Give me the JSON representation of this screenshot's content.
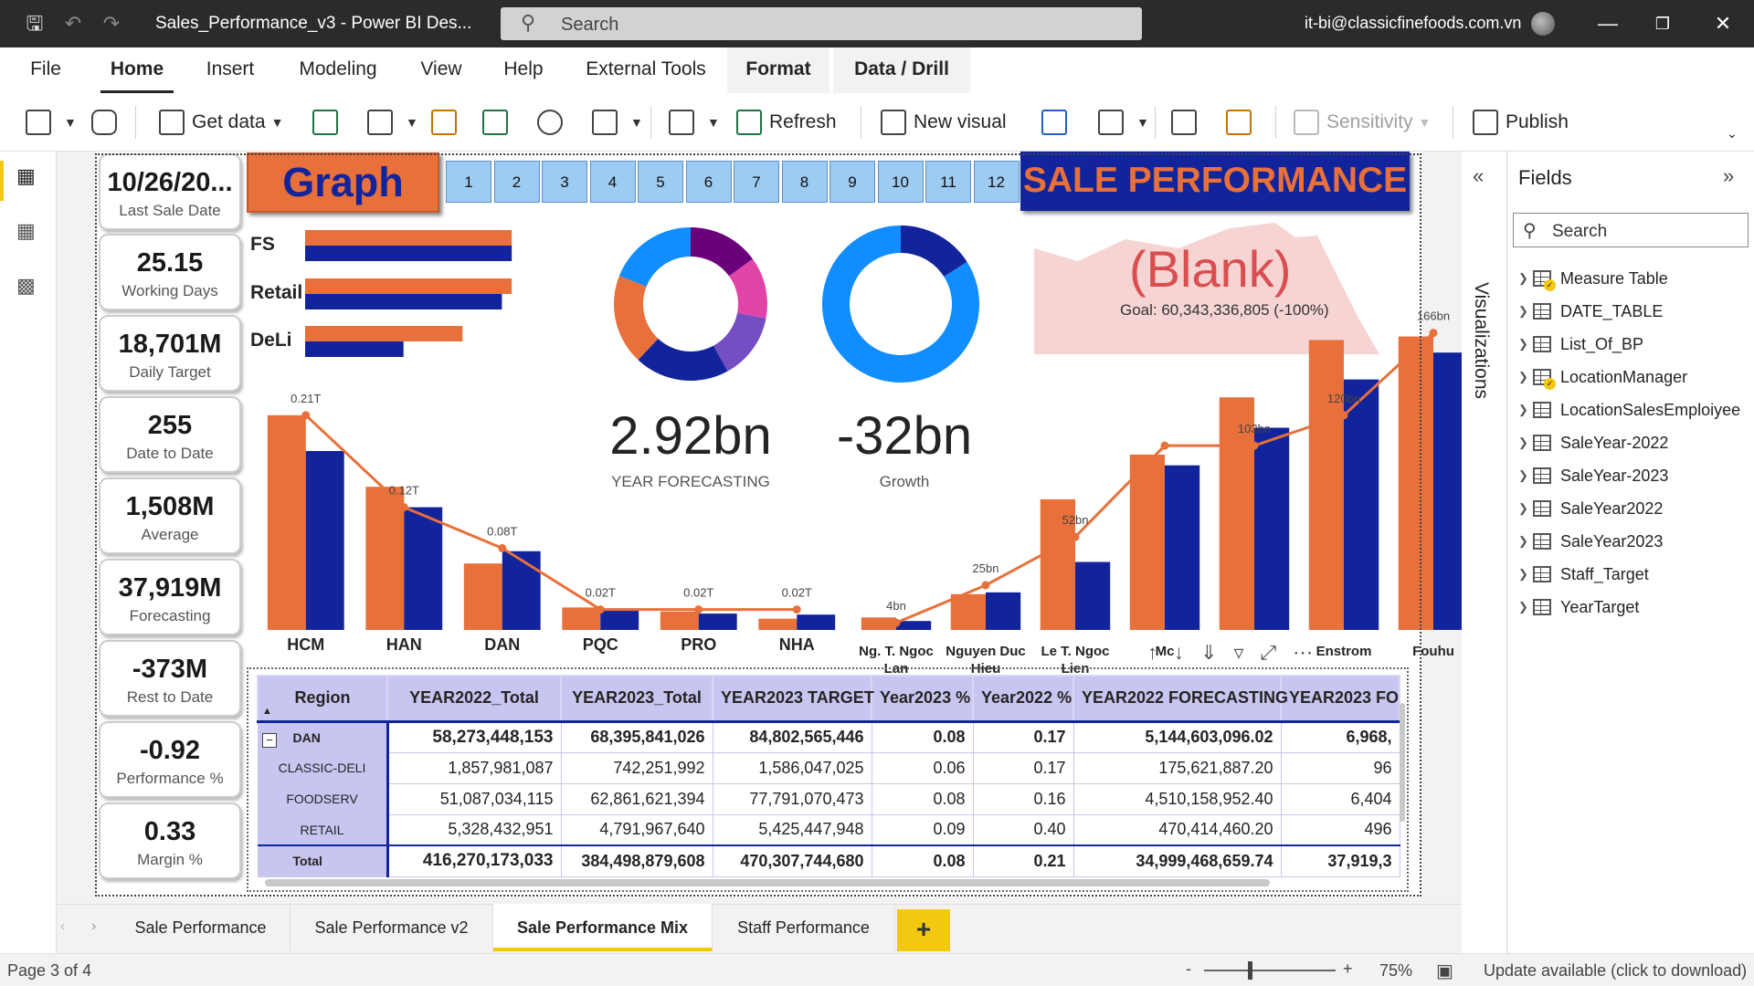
{
  "titlebar": {
    "doc_title": "Sales_Performance_v3 - Power BI Des...",
    "search_placeholder": "Search",
    "user": "it-bi@classicfinefoods.com.vn"
  },
  "menu": {
    "file": "File",
    "home": "Home",
    "insert": "Insert",
    "modeling": "Modeling",
    "view": "View",
    "help": "Help",
    "external": "External Tools",
    "format": "Format",
    "datadrill": "Data / Drill"
  },
  "ribbon": {
    "get_data": "Get data",
    "refresh": "Refresh",
    "new_visual": "New visual",
    "sensitivity": "Sensitivity",
    "publish": "Publish"
  },
  "kpis": [
    {
      "value": "10/26/20...",
      "label": "Last Sale Date"
    },
    {
      "value": "25.15",
      "label": "Working Days"
    },
    {
      "value": "18,701M",
      "label": "Daily Target"
    },
    {
      "value": "255",
      "label": "Date to Date"
    },
    {
      "value": "1,508M",
      "label": "Average"
    },
    {
      "value": "37,919M",
      "label": "Forecasting"
    },
    {
      "value": "-373M",
      "label": "Rest to Date"
    },
    {
      "value": "-0.92",
      "label": "Performance %"
    },
    {
      "value": "0.33",
      "label": "Margin %"
    }
  ],
  "graph_button": "Graph",
  "months": [
    "1",
    "2",
    "3",
    "4",
    "5",
    "6",
    "7",
    "8",
    "9",
    "10",
    "11",
    "12"
  ],
  "banner": "SALE PERFORMANCE",
  "blank_card": {
    "value": "(Blank)",
    "goal": "Goal: 60,343,336,805 (-100%)"
  },
  "forecast": {
    "value": "2.92bn",
    "label": "YEAR FORECASTING"
  },
  "growth": {
    "value": "-32bn",
    "label": "Growth"
  },
  "colors": {
    "orange": "#e8703a",
    "navy": "#12249b",
    "blue": "#118dff",
    "purple": "#6b007b",
    "magenta": "#e044a7",
    "violet": "#744ec2"
  },
  "chart_data": [
    {
      "type": "bar",
      "orientation": "horizontal",
      "categories": [
        "FS",
        "Retail",
        "DeLi"
      ],
      "series": [
        {
          "values": [
            63,
            63,
            48
          ]
        },
        {
          "values": [
            63,
            60,
            30
          ]
        }
      ]
    },
    {
      "type": "pie",
      "variant": "donut",
      "slices": [
        {
          "color": "#6b007b",
          "value": 15
        },
        {
          "color": "#e044a7",
          "value": 13
        },
        {
          "color": "#744ec2",
          "value": 14
        },
        {
          "color": "#12249b",
          "value": 20
        },
        {
          "color": "#e8703a",
          "value": 19
        },
        {
          "color": "#118dff",
          "value": 19
        }
      ]
    },
    {
      "type": "pie",
      "variant": "donut",
      "slices": [
        {
          "color": "#12249b",
          "value": 16
        },
        {
          "color": "#118dff",
          "value": 84
        }
      ]
    },
    {
      "type": "bar",
      "categories": [
        "HCM",
        "HAN",
        "DAN",
        "PQC",
        "PRO",
        "NHA"
      ],
      "series": [
        {
          "values": [
            0.21,
            0.14,
            0.065,
            0.022,
            0.018,
            0.011
          ]
        },
        {
          "values": [
            0.175,
            0.12,
            0.077,
            0.02,
            0.016,
            0.015
          ]
        }
      ],
      "line": {
        "values": [
          0.21,
          0.12,
          0.08,
          0.02,
          0.02,
          0.02
        ],
        "labels": [
          "0.21T",
          "0.12T",
          "0.08T",
          "0.02T",
          "0.02T",
          "0.02T"
        ]
      },
      "ylim": [
        0,
        0.25
      ]
    },
    {
      "type": "bar",
      "categories": [
        "Ng. T. Ngoc Lan",
        "Nguyen Duc Hieu",
        "Le T. Ngoc Lien",
        "Mc",
        "",
        "Enstrom",
        "Fouhu"
      ],
      "series": [
        {
          "values": [
            7,
            20,
            73,
            98,
            130,
            162,
            164
          ]
        },
        {
          "values": [
            5,
            21,
            38,
            92,
            113,
            140,
            155
          ]
        }
      ],
      "line": {
        "values": [
          4,
          25,
          52,
          103,
          103,
          120,
          166
        ],
        "labels": [
          "4bn",
          "25bn",
          "52bn",
          "",
          "103bn",
          "120bn",
          "166bn"
        ]
      },
      "ylim": [
        0,
        190
      ]
    },
    {
      "type": "table",
      "columns": [
        "Region",
        "YEAR2022_Total",
        "YEAR2023_Total",
        "YEAR2023 TARGET",
        "Year2023 %",
        "Year2022 %",
        "YEAR2022 FORECASTING",
        "YEAR2023 FO"
      ],
      "rows": [
        {
          "cells": [
            "DAN",
            "58,273,448,153",
            "68,395,841,026",
            "84,802,565,446",
            "0.08",
            "0.17",
            "5,144,603,096.02",
            "6,968,"
          ],
          "bold": true,
          "group": true
        },
        {
          "cells": [
            "CLASSIC-DELI",
            "1,857,981,087",
            "742,251,992",
            "1,586,047,025",
            "0.06",
            "0.17",
            "175,621,887.20",
            "96"
          ],
          "bold": false
        },
        {
          "cells": [
            "FOODSERV",
            "51,087,034,115",
            "62,861,621,394",
            "77,791,070,473",
            "0.08",
            "0.16",
            "4,510,158,952.40",
            "6,404"
          ],
          "bold": false
        },
        {
          "cells": [
            "RETAIL",
            "5,328,432,951",
            "4,791,967,640",
            "5,425,447,948",
            "0.09",
            "0.40",
            "470,414,460.20",
            "496"
          ],
          "bold": false
        },
        {
          "cells": [
            "Total",
            "416,270,173,033",
            "384,498,879,608",
            "470,307,744,680",
            "0.08",
            "0.21",
            "34,999,468,659.74",
            "37,919,3"
          ],
          "bold": true,
          "total": true
        }
      ]
    }
  ],
  "fields": {
    "title": "Fields",
    "search": "Search",
    "viz_label": "Visualizations",
    "items": [
      "Measure Table",
      "DATE_TABLE",
      "List_Of_BP",
      "LocationManager",
      "LocationSalesEmploiyee",
      "SaleYear-2022",
      "SaleYear-2023",
      "SaleYear2022",
      "SaleYear2023",
      "Staff_Target",
      "YearTarget"
    ]
  },
  "tabs": [
    "Sale Performance",
    "Sale Performance v2",
    "Sale Performance Mix",
    "Staff Performance"
  ],
  "tab_add": "+",
  "status": {
    "page": "Page 3 of 4",
    "zoom": "75%",
    "update": "Update available (click to download)",
    "minus": "-",
    "plus": "+"
  }
}
